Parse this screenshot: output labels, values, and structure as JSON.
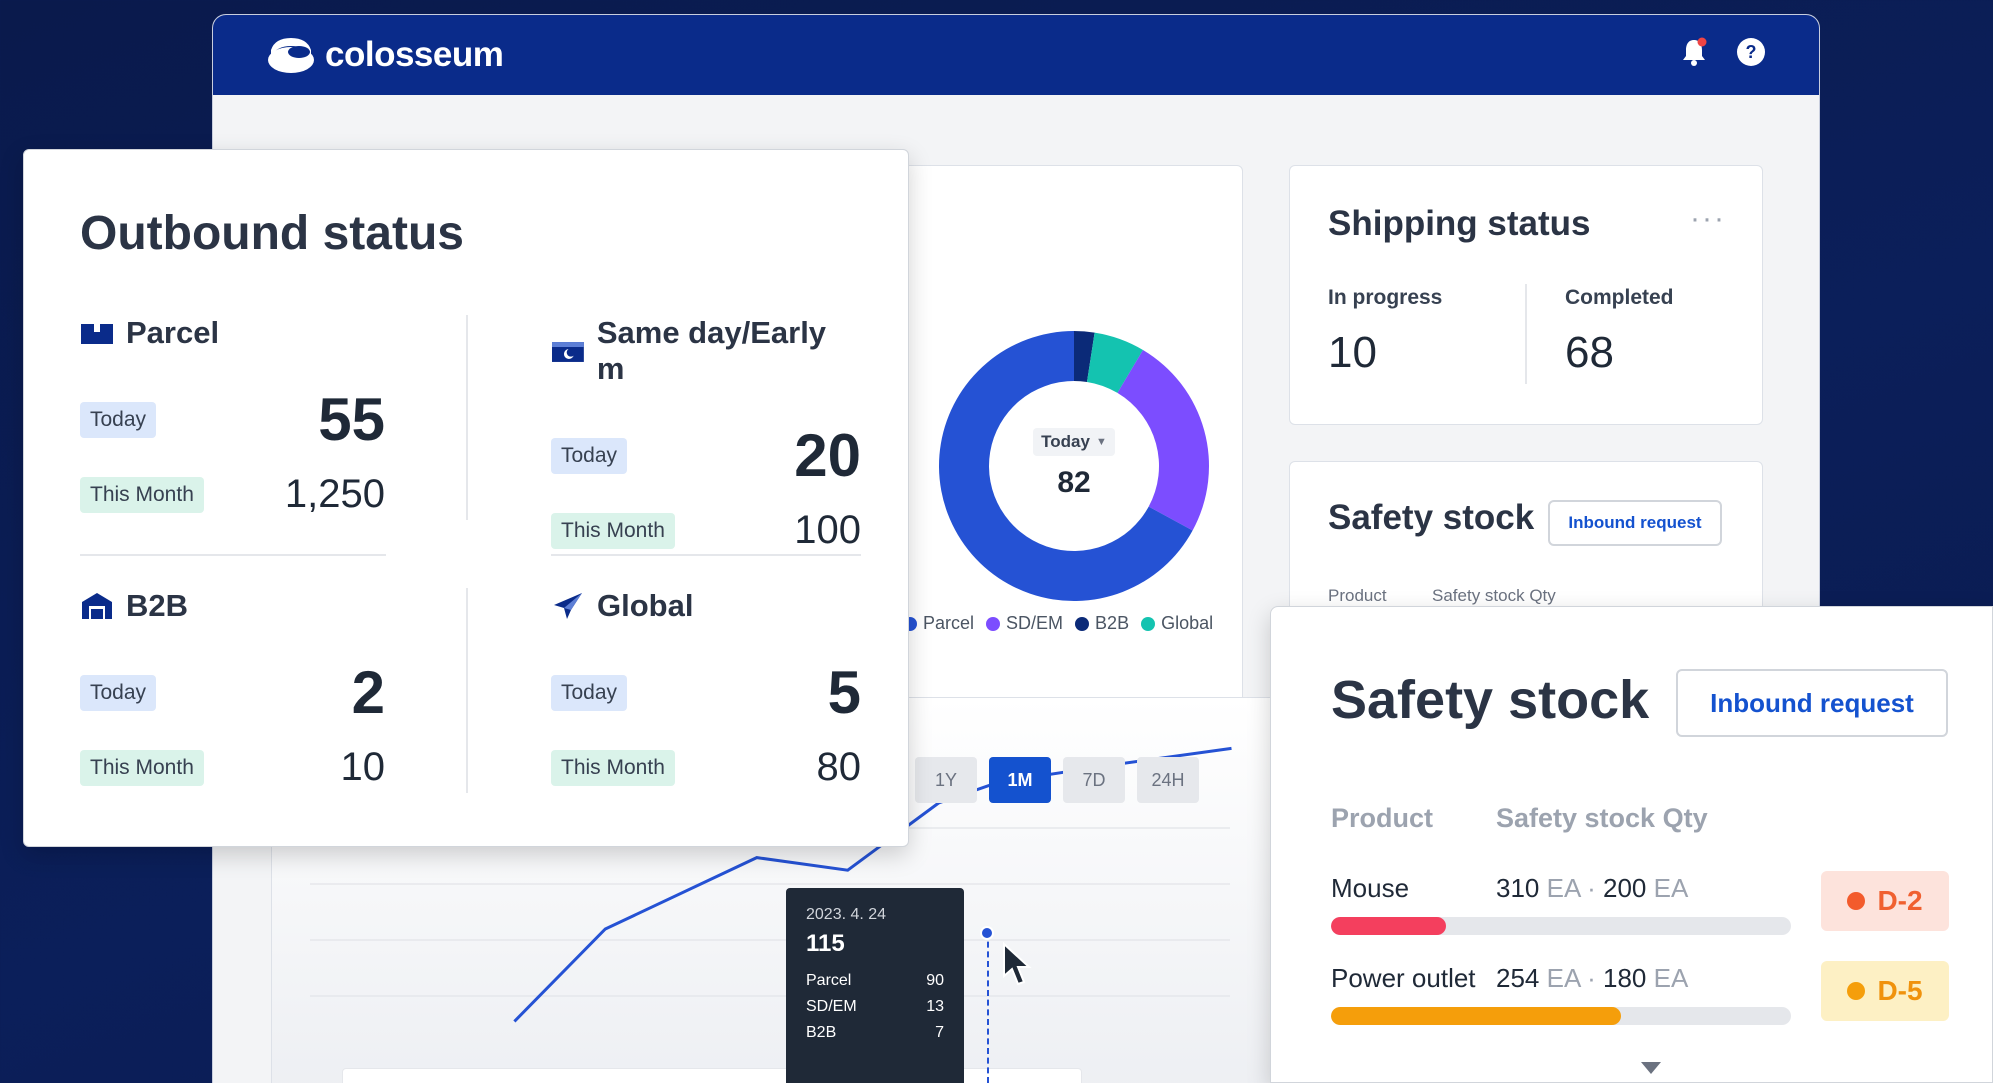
{
  "app": {
    "name": "colosseum"
  },
  "donut": {
    "period_label": "Today",
    "total": "82",
    "legend": [
      "Parcel",
      "SD/EM",
      "B2B",
      "Global"
    ],
    "slices": [
      {
        "name": "Parcel",
        "value": 55,
        "color": "#2552d4"
      },
      {
        "name": "SD/EM",
        "value": 20,
        "color": "#7c4dff"
      },
      {
        "name": "B2B",
        "value": 2,
        "color": "#0b2a78"
      },
      {
        "name": "Global",
        "value": 5,
        "color": "#14c3b0"
      }
    ]
  },
  "range_buttons": [
    "1Y",
    "1M",
    "7D",
    "24H"
  ],
  "range_active": "1M",
  "line_chart": {
    "points": [
      [
        0.24,
        0.77
      ],
      [
        0.33,
        0.55
      ],
      [
        0.48,
        0.38
      ],
      [
        0.57,
        0.41
      ],
      [
        0.66,
        0.25
      ],
      [
        0.72,
        0.2
      ],
      [
        0.83,
        0.16
      ],
      [
        0.95,
        0.12
      ]
    ]
  },
  "tooltip": {
    "date": "2023. 4. 24",
    "total": "115",
    "rows": [
      {
        "label": "Parcel",
        "value": "90"
      },
      {
        "label": "SD/EM",
        "value": "13"
      },
      {
        "label": "B2B",
        "value": "7"
      }
    ]
  },
  "shipping": {
    "title": "Shipping status",
    "more": "···",
    "in_progress_label": "In progress",
    "in_progress_value": "10",
    "completed_label": "Completed",
    "completed_value": "68"
  },
  "safety_bg": {
    "title": "Safety stock",
    "button": "Inbound request",
    "col_product": "Product",
    "col_qty": "Safety stock Qty"
  },
  "outbound": {
    "title": "Outbound status",
    "today_label": "Today",
    "month_label": "This Month",
    "parcel": {
      "label": "Parcel",
      "today": "55",
      "month": "1,250"
    },
    "sameday": {
      "label": "Same day/Early m",
      "today": "20",
      "month": "100"
    },
    "b2b": {
      "label": "B2B",
      "today": "2",
      "month": "10"
    },
    "global": {
      "label": "Global",
      "today": "5",
      "month": "80"
    }
  },
  "safety": {
    "title": "Safety stock",
    "button": "Inbound request",
    "col_product": "Product",
    "col_qty": "Safety stock Qty",
    "unit": "EA",
    "items": [
      {
        "name": "Mouse",
        "current": "310",
        "safety": "200",
        "fill": 0.25,
        "color": "#f43f5e",
        "badge": "D-2",
        "badge_bg": "#fde3dc",
        "badge_color": "#f06030",
        "dot": "#f35b2c"
      },
      {
        "name": "Power outlet",
        "current": "254",
        "safety": "180",
        "fill": 0.63,
        "color": "#f59e0b",
        "badge": "D-5",
        "badge_bg": "#fdf0c4",
        "badge_color": "#f0920c",
        "dot": "#f59e0b"
      }
    ]
  }
}
